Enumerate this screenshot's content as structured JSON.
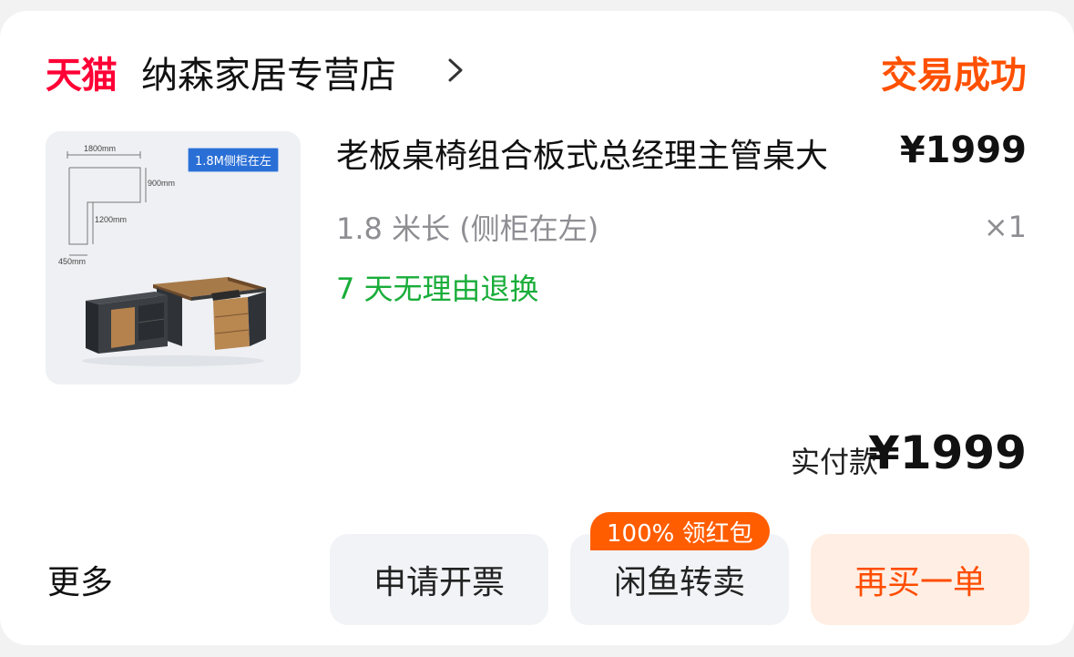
{
  "header": {
    "platform_logo": "天猫",
    "store_name": "纳森家居专营店",
    "status": "交易成功"
  },
  "product": {
    "title": "老板桌椅组合板式总经理主管桌大",
    "price": "¥1999",
    "sku": "1.8 米长 (侧柜在左)",
    "quantity": "×1",
    "return_policy": "7 天无理由退换",
    "image": {
      "tag": "1.8M侧柜在左",
      "dim_width": "1800mm",
      "dim_depth": "900mm",
      "dim_side_length": "1200mm",
      "dim_side_depth": "450mm"
    }
  },
  "payment": {
    "label": "实付款",
    "amount": "¥1999"
  },
  "footer": {
    "more_label": "更多",
    "invoice_button": "申请开票",
    "resell_button": "闲鱼转卖",
    "resell_badge": "100% 领红包",
    "rebuy_button": "再买一单"
  },
  "colors": {
    "tmall_red": "#ff0036",
    "status_orange": "#ff5000",
    "return_green": "#1aad3a",
    "rebuy_bg": "#ffeee3"
  }
}
